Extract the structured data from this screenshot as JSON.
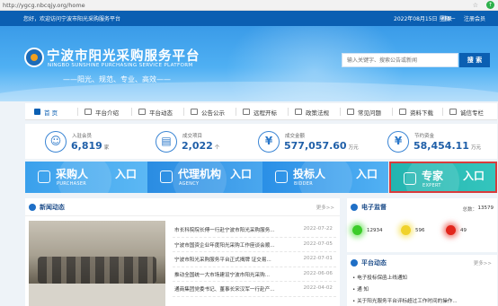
{
  "browser": {
    "url": "http://ygcg.nbcqjy.org/home",
    "star_icon": "star-icon",
    "up_icon": "arrow-up-icon"
  },
  "topbar": {
    "welcome": "您好，欢迎访问宁波市阳光采购服务平台",
    "date": "2022年08月15日 星期一",
    "login": "登录",
    "register": "注册会员"
  },
  "header": {
    "title": "宁波市阳光采购服务平台",
    "subtitle": "NINGBO SUNSHINE PURCHASING SERVICE PLATFORM",
    "slogan": "——阳光、规范、专业、高效——",
    "search_placeholder": "输入关键字、搜索公告或新闻",
    "search_button": "搜 索"
  },
  "nav": [
    {
      "label": "首 页",
      "icon": "home-icon"
    },
    {
      "label": "平台介绍",
      "icon": "info-icon"
    },
    {
      "label": "平台动态",
      "icon": "news-icon"
    },
    {
      "label": "公告公示",
      "icon": "notice-icon"
    },
    {
      "label": "远程开标",
      "icon": "remote-bid-icon"
    },
    {
      "label": "政策法规",
      "icon": "policy-icon"
    },
    {
      "label": "常见问题",
      "icon": "question-icon"
    },
    {
      "label": "资料下载",
      "icon": "download-icon"
    },
    {
      "label": "诚信专栏",
      "icon": "credit-icon"
    }
  ],
  "stats": [
    {
      "label": "入驻会员",
      "value": "6,819",
      "unit": "家",
      "icon": "members-icon"
    },
    {
      "label": "成交项目",
      "value": "2,022",
      "unit": "个",
      "icon": "projects-icon"
    },
    {
      "label": "成交金额",
      "value": "577,057.60",
      "unit": "万元",
      "icon": "yuan-icon"
    },
    {
      "label": "节约资金",
      "value": "58,454.11",
      "unit": "万元",
      "icon": "savings-icon"
    }
  ],
  "entries": [
    {
      "title": "采购人",
      "en": "PURCHASER",
      "enter": "入口",
      "icon": "purchaser-icon"
    },
    {
      "title": "代理机构",
      "en": "AGENCY",
      "enter": "入口",
      "icon": "agency-icon"
    },
    {
      "title": "投标人",
      "en": "BIDDER",
      "enter": "入口",
      "icon": "bidder-icon"
    },
    {
      "title": "专家",
      "en": "EXPERT",
      "enter": "入口",
      "icon": "expert-icon"
    }
  ],
  "news": {
    "title": "新闻动态",
    "more": "更多>>",
    "items": [
      {
        "title": "市长科院院长傅一行赴宁波市阳光采购服务...",
        "date": "2022-07-22"
      },
      {
        "title": "宁波市国资企业年度阳光采购工作座谈会顺...",
        "date": "2022-07-05"
      },
      {
        "title": "宁波市阳光采购服务平台正式揭牌 证交易...",
        "date": "2022-07-01"
      },
      {
        "title": "推动全国统一大市场建设宁波市阳光采购...",
        "date": "2022-06-06"
      },
      {
        "title": "通商集团党委书记、董事长宋汉军一行赴产...",
        "date": "2022-04-02"
      }
    ]
  },
  "monitor": {
    "title": "电子监督",
    "total_label": "总数：",
    "total": "13579",
    "green": "12934",
    "yellow": "596",
    "red": "49",
    "colors": {
      "green": "#3ccc2a",
      "yellow": "#f0d22c",
      "red": "#e2261d"
    }
  },
  "platform": {
    "title": "平台动态",
    "more": "更多>>",
    "items": [
      "• 电子投标保函上线通知",
      "• 通 知",
      "• 关于阳光服务平台评标超过工作时间的操作..."
    ]
  }
}
